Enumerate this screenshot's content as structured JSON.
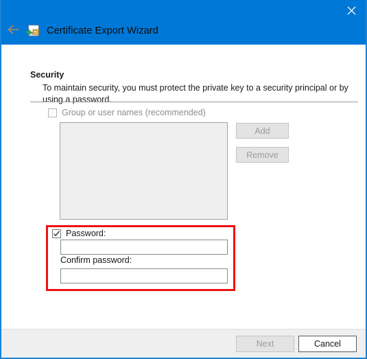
{
  "window": {
    "title": "Certificate Export Wizard",
    "accent_color": "#0078d7",
    "border_color": "#1683d8",
    "highlight_color": "#ee1111"
  },
  "titlebar": {
    "back_label": "Back",
    "close_label": "Close",
    "icon_name": "certificate-export-icon"
  },
  "main": {
    "heading": "Security",
    "description": "To maintain security, you must protect the private key to a security principal or by using a password.",
    "group_section": {
      "checkbox_label": "Group or user names (recommended)",
      "checkbox_checked": false,
      "checkbox_enabled": false,
      "list_items": [],
      "add_label": "Add",
      "add_enabled": false,
      "remove_label": "Remove",
      "remove_enabled": false
    },
    "password_section": {
      "checkbox_label": "Password:",
      "checkbox_checked": true,
      "password_value": "",
      "confirm_label": "Confirm password:",
      "confirm_value": ""
    }
  },
  "footer": {
    "next_label": "Next",
    "next_enabled": false,
    "cancel_label": "Cancel",
    "cancel_enabled": true
  }
}
